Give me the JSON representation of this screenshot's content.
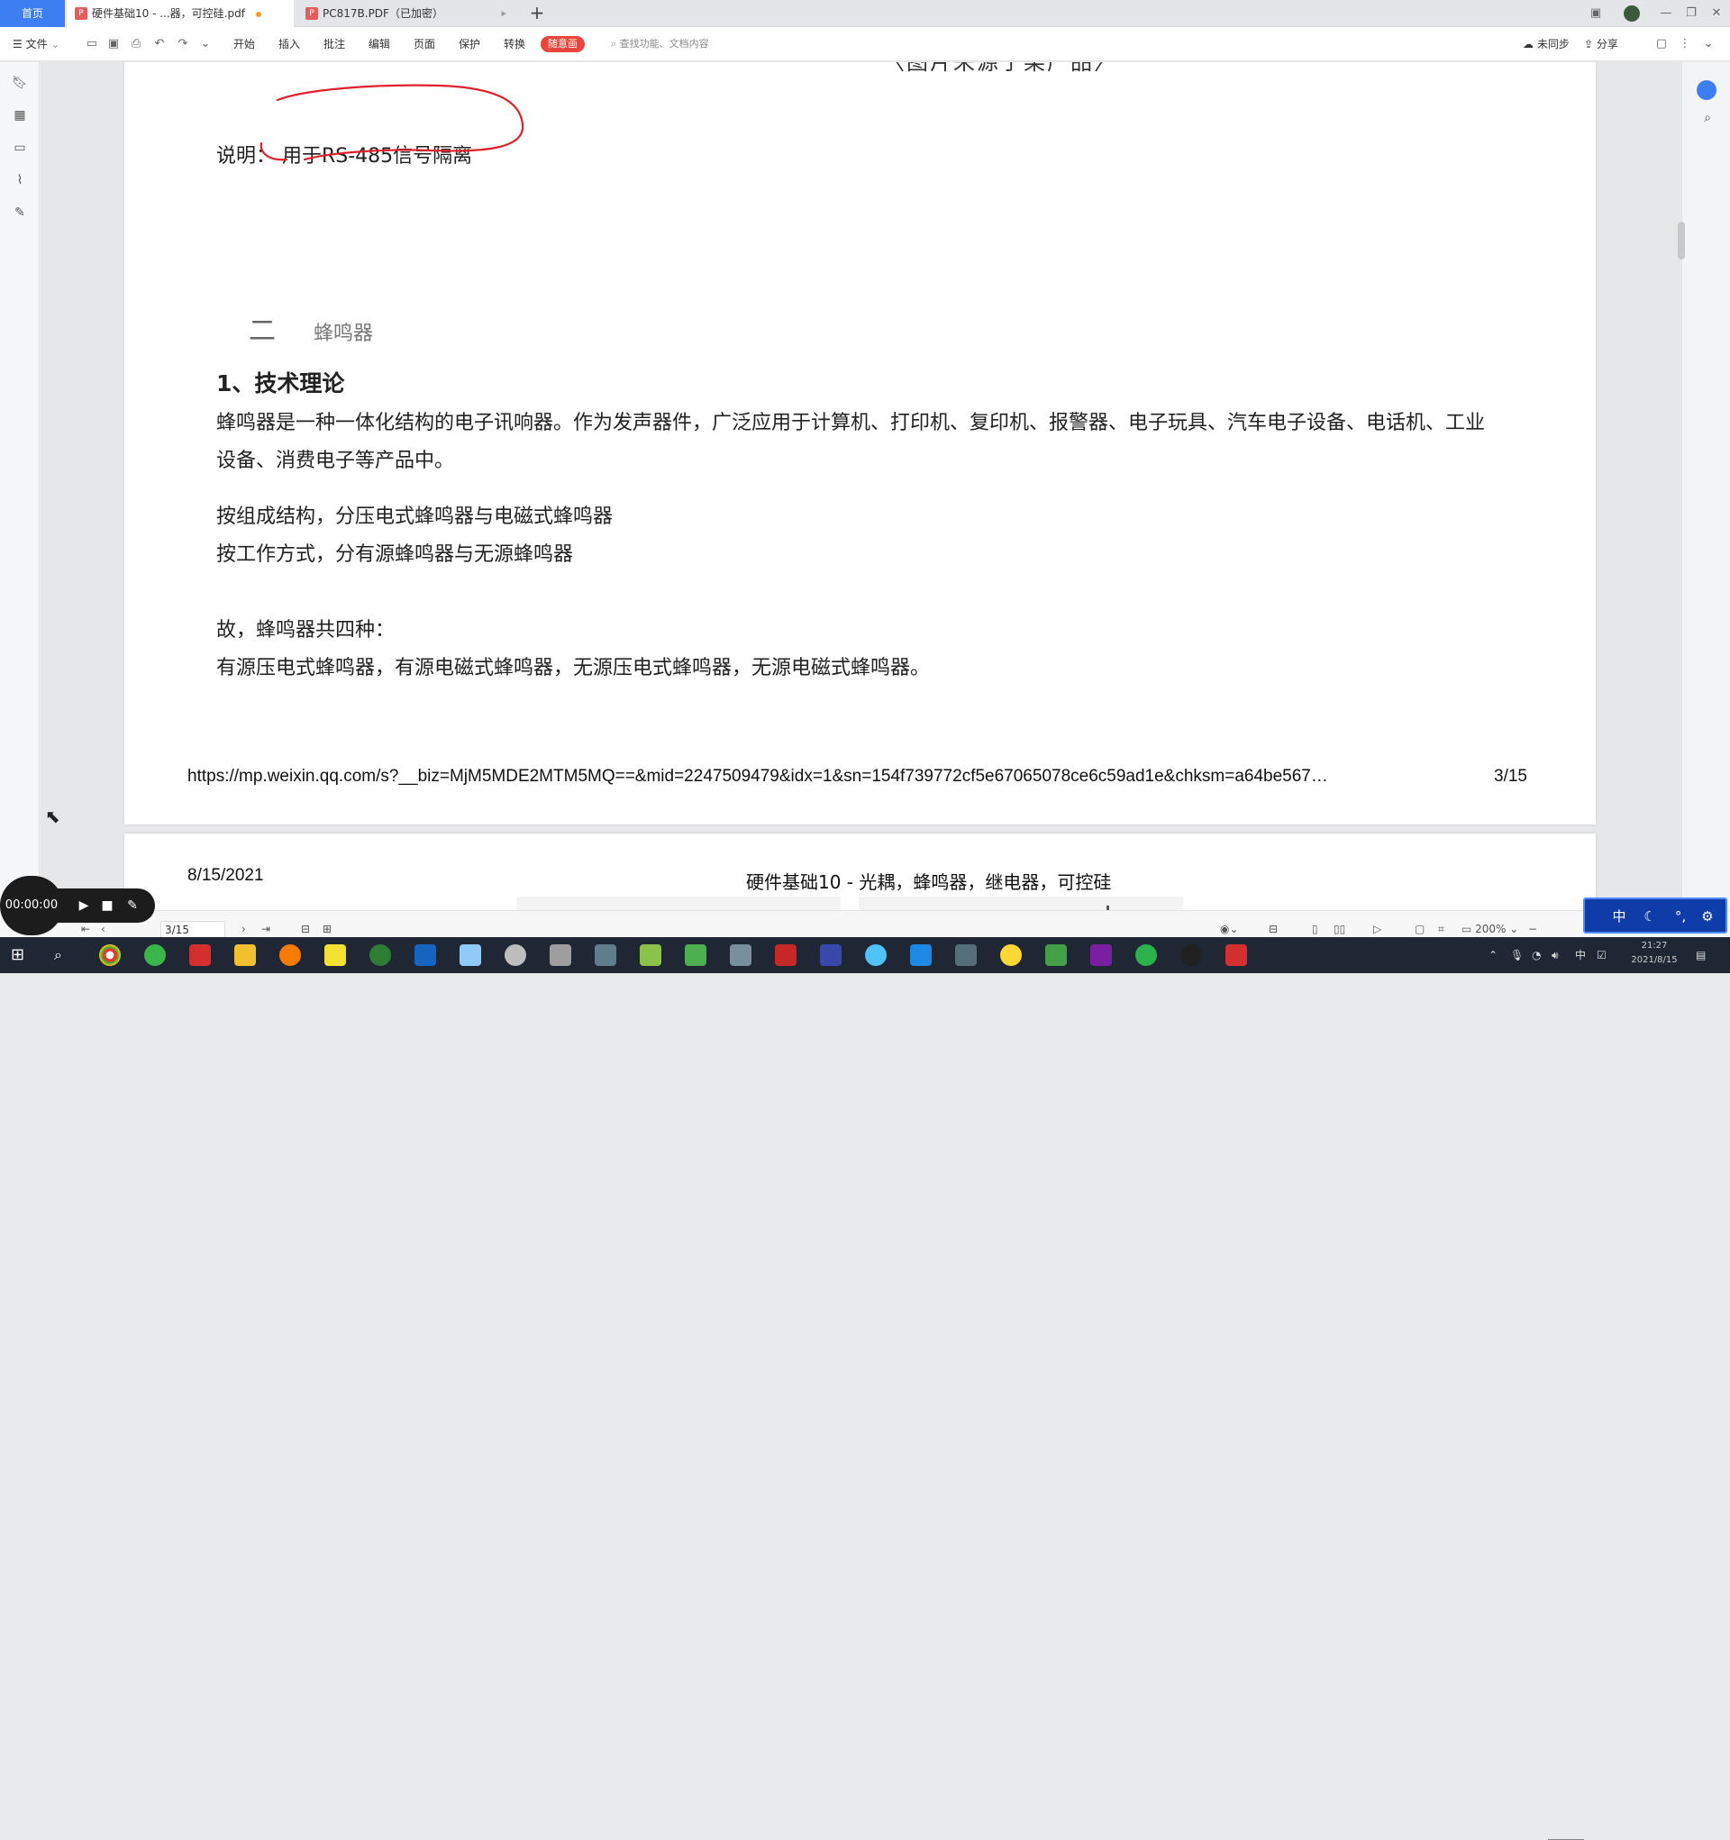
{
  "tabs": {
    "home": "首页",
    "doc1": "硬件基础10 - ...器，可控硅.pdf",
    "doc2": "PC817B.PDF（已加密）",
    "add": "+"
  },
  "toolbar": {
    "file": "文件",
    "menus": [
      "开始",
      "插入",
      "批注",
      "编辑",
      "页面",
      "保护",
      "转换"
    ],
    "highlight": "随意画",
    "search_placeholder": "查找功能、文档内容",
    "sync": "未同步",
    "share": "分享"
  },
  "page1": {
    "caption_partial": "〈图片来源于某产品〉",
    "note": "说明：  用于RS-485信号隔离",
    "section_number": "二",
    "section_title": "蜂鸣器",
    "heading": "1、技术理论",
    "para1": "蜂鸣器是一种一体化结构的电子讯响器。作为发声器件，广泛应用于计算机、打印机、复印机、报警器、电子玩具、汽车电子设备、电话机、工业设备、消费电子等产品中。",
    "para2_line1": "按组成结构，分压电式蜂鸣器与电磁式蜂鸣器",
    "para2_line2": "按工作方式，分有源蜂鸣器与无源蜂鸣器",
    "para3_line1": "故，蜂鸣器共四种：",
    "para3_line2": "有源压电式蜂鸣器，有源电磁式蜂鸣器，无源压电式蜂鸣器，无源电磁式蜂鸣器。",
    "footer_url": "https://mp.weixin.qq.com/s?__biz=MjM5MDE2MTM5MQ==&mid=2247509479&idx=1&sn=154f739772cf5e67065078ce6c59ad1e&chksm=a64be567…",
    "footer_page": "3/15"
  },
  "page2": {
    "date": "8/15/2021",
    "title": "硬件基础10 - 光耦，蜂鸣器，继电器，可控硅"
  },
  "statusbar": {
    "page_value": "3/15",
    "zoom": "200%",
    "zoom_minus": "−"
  },
  "recorder": {
    "time": "00:00:00"
  },
  "ime": {
    "mode": "中"
  },
  "tray": {
    "lang": "中",
    "time": "21:27",
    "date": "2021/8/15"
  },
  "colors": {
    "accent": "#3d7ff3",
    "pen": "#e0202a",
    "highlight_btn": "#e8453c"
  }
}
